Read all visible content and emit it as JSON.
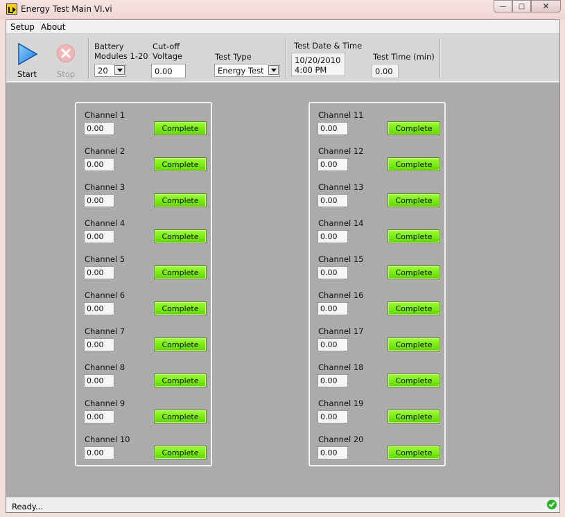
{
  "window": {
    "title": "Energy Test Main VI.vi"
  },
  "menu": [
    "Setup",
    "About"
  ],
  "toolbar": {
    "start_label": "Start",
    "stop_label": "Stop",
    "battery_label_1": "Battery",
    "battery_label_2": "Modules 1-20",
    "battery_value": "20",
    "cutoff_label_1": "Cut-off",
    "cutoff_label_2": "Voltage",
    "cutoff_value": "0.00",
    "test_type_label": "Test Type",
    "test_type_value": "Energy Test",
    "date_label": "Test Date & Time",
    "date_line1": "10/20/2010",
    "date_line2": "4:00 PM",
    "time_label": "Test Time (min)",
    "time_value": "0.00"
  },
  "channels": [
    {
      "label": "Channel 1",
      "value": "0.00",
      "status": "Complete"
    },
    {
      "label": "Channel 2",
      "value": "0.00",
      "status": "Complete"
    },
    {
      "label": "Channel 3",
      "value": "0.00",
      "status": "Complete"
    },
    {
      "label": "Channel 4",
      "value": "0.00",
      "status": "Complete"
    },
    {
      "label": "Channel 5",
      "value": "0.00",
      "status": "Complete"
    },
    {
      "label": "Channel 6",
      "value": "0.00",
      "status": "Complete"
    },
    {
      "label": "Channel 7",
      "value": "0.00",
      "status": "Complete"
    },
    {
      "label": "Channel 8",
      "value": "0.00",
      "status": "Complete"
    },
    {
      "label": "Channel 9",
      "value": "0.00",
      "status": "Complete"
    },
    {
      "label": "Channel 10",
      "value": "0.00",
      "status": "Complete"
    },
    {
      "label": "Channel 11",
      "value": "0.00",
      "status": "Complete"
    },
    {
      "label": "Channel 12",
      "value": "0.00",
      "status": "Complete"
    },
    {
      "label": "Channel 13",
      "value": "0.00",
      "status": "Complete"
    },
    {
      "label": "Channel 14",
      "value": "0.00",
      "status": "Complete"
    },
    {
      "label": "Channel 15",
      "value": "0.00",
      "status": "Complete"
    },
    {
      "label": "Channel 16",
      "value": "0.00",
      "status": "Complete"
    },
    {
      "label": "Channel 17",
      "value": "0.00",
      "status": "Complete"
    },
    {
      "label": "Channel 18",
      "value": "0.00",
      "status": "Complete"
    },
    {
      "label": "Channel 19",
      "value": "0.00",
      "status": "Complete"
    },
    {
      "label": "Channel 20",
      "value": "0.00",
      "status": "Complete"
    }
  ],
  "status": {
    "text": "Ready..."
  },
  "colors": {
    "panel_bg": "#ababab",
    "complete_green": "#7cf21a",
    "start_blue": "#1e78e0",
    "stop_red": "#e05050"
  }
}
